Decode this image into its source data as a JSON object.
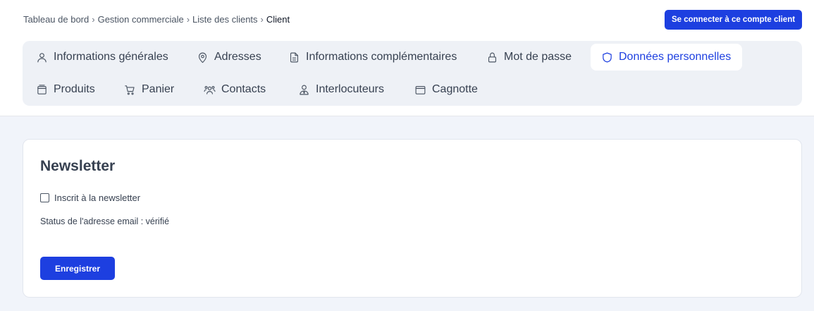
{
  "breadcrumb": {
    "items": [
      "Tableau de bord",
      "Gestion commerciale",
      "Liste des clients"
    ],
    "separator": "›",
    "current": "Client"
  },
  "header": {
    "login_button": "Se connecter à ce compte client"
  },
  "tabs": [
    {
      "label": "Informations générales",
      "icon": "user-icon",
      "active": false
    },
    {
      "label": "Adresses",
      "icon": "map-pin-icon",
      "active": false
    },
    {
      "label": "Informations complémentaires",
      "icon": "document-icon",
      "active": false
    },
    {
      "label": "Mot de passe",
      "icon": "lock-icon",
      "active": false
    },
    {
      "label": "Données personnelles",
      "icon": "shield-icon",
      "active": true
    },
    {
      "label": "Produits",
      "icon": "box-icon",
      "active": false
    },
    {
      "label": "Panier",
      "icon": "cart-icon",
      "active": false
    },
    {
      "label": "Contacts",
      "icon": "users-icon",
      "active": false
    },
    {
      "label": "Interlocuteurs",
      "icon": "person-tie-icon",
      "active": false
    },
    {
      "label": "Cagnotte",
      "icon": "wallet-icon",
      "active": false
    }
  ],
  "newsletter": {
    "title": "Newsletter",
    "checkbox_label": "Inscrit à la newsletter",
    "checked": false,
    "status_text": "Status de l'adresse email : vérifié",
    "save_button": "Enregistrer"
  },
  "colors": {
    "accent": "#1d3fe0",
    "page_background": "#f1f4fa",
    "tabs_background": "#eef1f6"
  }
}
